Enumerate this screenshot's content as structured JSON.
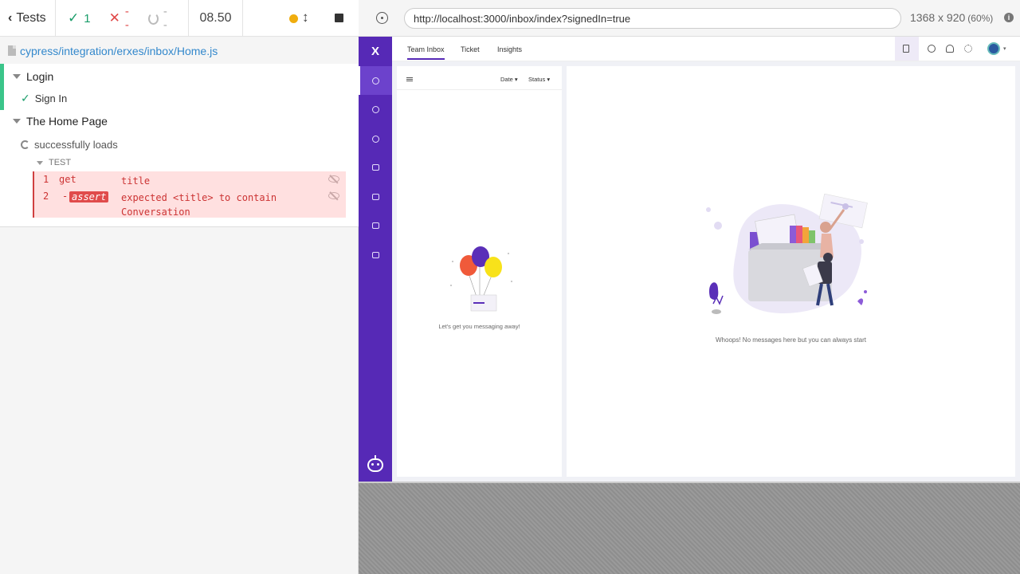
{
  "reporter": {
    "tests_label": "Tests",
    "passed": "1",
    "failed": "--",
    "pending": "--",
    "duration": "08.50",
    "spec_path": "cypress/integration/erxes/inbox/Home.js",
    "suites": [
      {
        "title": "Login",
        "tests": [
          {
            "title": "Sign In",
            "state": "passed"
          }
        ]
      },
      {
        "title": "The Home Page",
        "tests": [
          {
            "title": "successfully loads",
            "state": "running"
          }
        ]
      }
    ],
    "test_section_label": "TEST",
    "commands": [
      {
        "number": "1",
        "name": "get",
        "message": "title"
      },
      {
        "number": "2",
        "name": "-",
        "badge": "assert",
        "message": "expected <title> to contain Conversation"
      }
    ]
  },
  "aut": {
    "url": "http://localhost:3000/inbox/index?signedIn=true",
    "viewport": "1368 x 920",
    "scale": "(60%)"
  },
  "app": {
    "logo": "X",
    "tabs": [
      "Team Inbox",
      "Ticket",
      "Insights"
    ],
    "active_tab": "Team Inbox",
    "filters": {
      "date": "Date",
      "status": "Status"
    },
    "empty_list_message": "Let's get you messaging away!",
    "empty_detail_message": "Whoops! No messages here but you can always start",
    "colors": {
      "sidebar": "#5629b6",
      "accent": "#5629b6"
    }
  }
}
